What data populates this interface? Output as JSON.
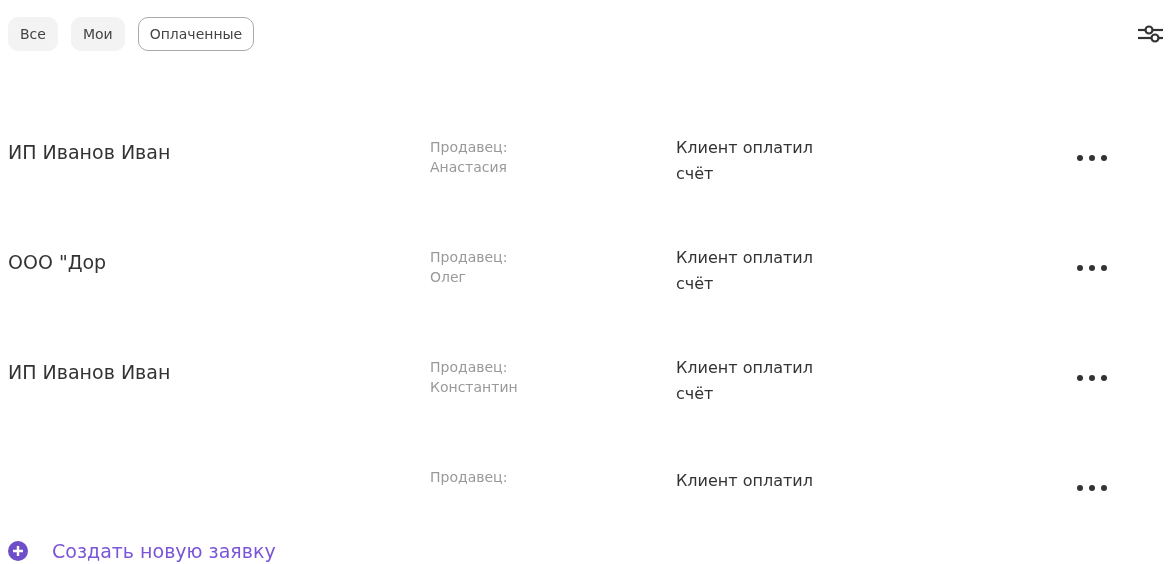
{
  "tabs": [
    {
      "label": "Все",
      "selected": false
    },
    {
      "label": "Мои",
      "selected": false
    },
    {
      "label": "Оплаченные",
      "selected": true
    }
  ],
  "rows": [
    {
      "client": "ИП Иванов Иван",
      "seller_label": "Продавец:",
      "seller": "Анастасия",
      "status": "Клиент оплатил счёт"
    },
    {
      "client": "ООО \"Дор",
      "seller_label": "Продавец:",
      "seller": "Олег",
      "status": "Клиент оплатил счёт"
    },
    {
      "client": "ИП Иванов Иван",
      "seller_label": "Продавец:",
      "seller": "Константин",
      "status": "Клиент оплатил счёт"
    },
    {
      "seller_label": "Продавец:",
      "status": "Клиент оплатил"
    }
  ],
  "create_link": "Создать новую заявку"
}
